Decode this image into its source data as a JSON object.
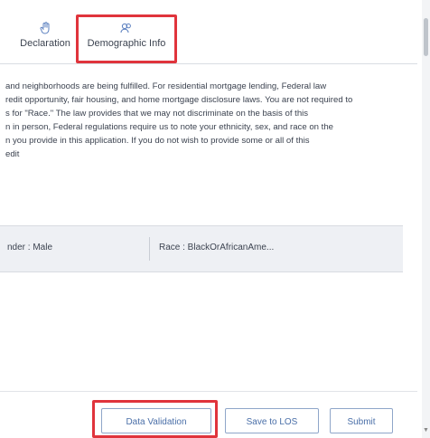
{
  "tabs": [
    {
      "label": "Declaration",
      "icon": "hand-icon"
    },
    {
      "label": "Demographic Info",
      "icon": "people-icon",
      "active": true
    }
  ],
  "disclosure_lines": [
    "and neighborhoods are being fulfilled. For residential mortgage lending, Federal law",
    "redit opportunity, fair housing, and home mortgage disclosure laws. You are not required to",
    "s for \"Race.\" The law provides that we may not discriminate on the basis of this",
    "n in person, Federal regulations require us to note your ethnicity, sex, and race on the",
    "n you provide in this application. If you do not wish to provide some or all of this",
    "edit"
  ],
  "summary": {
    "gender": "nder : Male",
    "race": "Race : BlackOrAfricanAme..."
  },
  "footer": {
    "validate_label": "Data Validation",
    "save_label": "Save to LOS",
    "submit_label": "Submit"
  },
  "colors": {
    "accent": "#4f7fd0",
    "highlight": "#e0343c",
    "button_text": "#4a6fa8",
    "summary_bg": "#eef0f4"
  }
}
